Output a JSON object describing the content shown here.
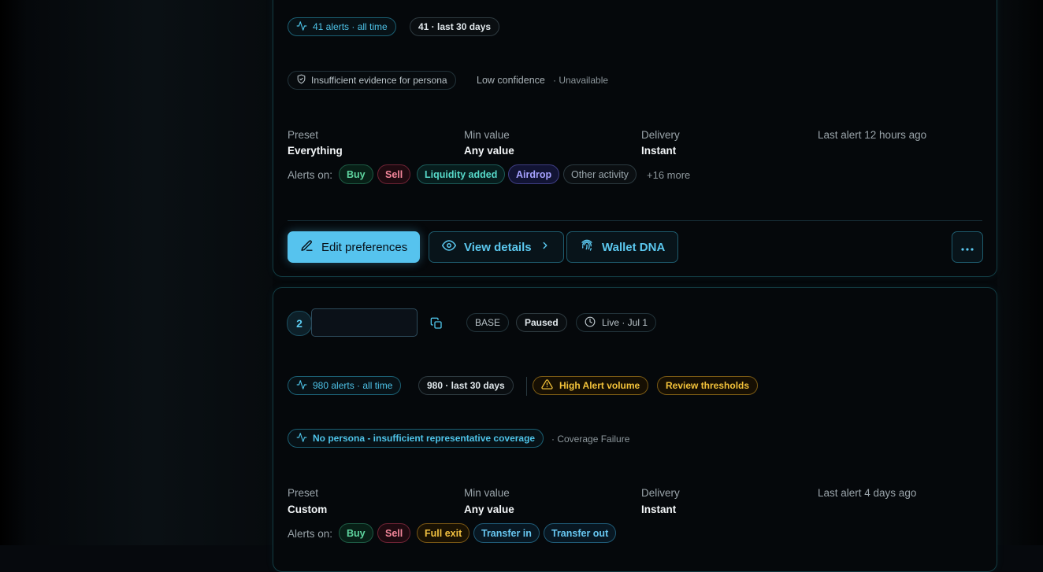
{
  "card1": {
    "alerts_all_time": "41 alerts · all time",
    "alerts_30d": "41 · last 30 days",
    "persona": "Insufficient evidence for persona",
    "confidence": "Low confidence",
    "availability": "· Unavailable",
    "preset_label": "Preset",
    "preset_value": "Everything",
    "min_label": "Min value",
    "min_value": "Any value",
    "delivery_label": "Delivery",
    "delivery_value": "Instant",
    "last_alert": "Last alert 12 hours ago",
    "alerts_on_label": "Alerts on:",
    "tags": [
      "Buy",
      "Sell",
      "Liquidity added",
      "Airdrop",
      "Other activity"
    ],
    "more": "+16 more",
    "edit_label": "Edit preferences",
    "view_label": "View details",
    "dna_label": "Wallet DNA"
  },
  "card2": {
    "index": "2",
    "name_value": "",
    "chain": "BASE",
    "status": "Paused",
    "live": "Live · Jul 1",
    "alerts_all_time": "980 alerts · all time",
    "alerts_30d": "980 · last 30 days",
    "warning": "High Alert volume",
    "review": "Review thresholds",
    "persona": "No persona - insufficient representative coverage",
    "coverage": "· Coverage Failure",
    "preset_label": "Preset",
    "preset_value": "Custom",
    "min_label": "Min value",
    "min_value": "Any value",
    "delivery_label": "Delivery",
    "delivery_value": "Instant",
    "last_alert": "Last alert 4 days ago",
    "alerts_on_label": "Alerts on:",
    "tags": [
      "Buy",
      "Sell",
      "Full exit",
      "Transfer in",
      "Transfer out"
    ]
  },
  "colors": {
    "accent": "#56c3ee",
    "warning": "#f3c23a",
    "border": "#123b42"
  },
  "icons": [
    "activity-icon",
    "shield-icon",
    "pencil-icon",
    "eye-icon",
    "chevron-right-icon",
    "fingerprint-icon",
    "more-icon",
    "copy-icon",
    "clock-icon",
    "warning-icon"
  ]
}
